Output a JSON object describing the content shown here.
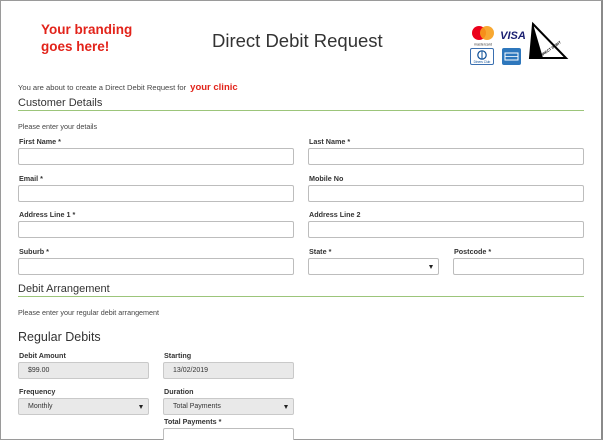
{
  "header": {
    "branding": "Your branding goes here!",
    "title": "Direct Debit Request",
    "logos": {
      "mastercard_text": "mastercard",
      "visa_text": "VISA",
      "diners_text": "Diners Club",
      "direct_debit_text": "DIRECT DEBIT"
    }
  },
  "intro": {
    "text": "You are about to create a Direct Debit Request for",
    "clinic": "your clinic"
  },
  "customer": {
    "heading": "Customer Details",
    "note": "Please enter your details",
    "first_name": "First Name *",
    "last_name": "Last Name *",
    "email": "Email *",
    "mobile": "Mobile No",
    "address1": "Address Line 1 *",
    "address2": "Address Line 2",
    "suburb": "Suburb *",
    "state": "State *",
    "postcode": "Postcode *"
  },
  "debit": {
    "heading": "Debit Arrangement",
    "note": "Please enter your regular debit arrangement"
  },
  "regular": {
    "heading": "Regular Debits",
    "debit_amount_label": "Debit Amount",
    "debit_amount_value": "$99.00",
    "starting_label": "Starting",
    "starting_value": "13/02/2019",
    "frequency_label": "Frequency",
    "frequency_value": "Monthly",
    "duration_label": "Duration",
    "duration_value": "Total Payments",
    "total_payments_label": "Total Payments *"
  },
  "colors": {
    "brand_red": "#e2231a",
    "rule_green": "#9cc57a"
  }
}
